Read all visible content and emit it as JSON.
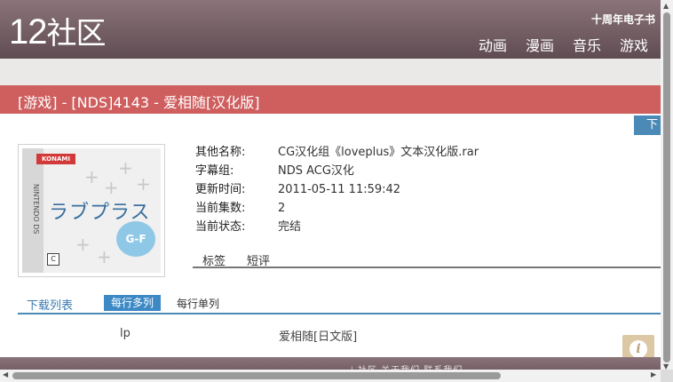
{
  "site": {
    "logo_num": "12",
    "logo_cn": "社区",
    "top_link": "十周年电子书",
    "nav": [
      "动画",
      "漫画",
      "音乐",
      "游戏"
    ]
  },
  "page": {
    "title": "[游戏] - [NDS]4143 - 爱相随[汉化版]",
    "download_tab": "下"
  },
  "cover": {
    "brand": "KONAMI",
    "platform": "NINTENDO DS",
    "title": "ラブプラス",
    "badge": "G-F",
    "rating": "C"
  },
  "info": [
    {
      "key": "其他名称:",
      "value": "CG汉化组《loveplus》文本汉化版.rar"
    },
    {
      "key": "字幕组:",
      "value": "NDS ACG汉化"
    },
    {
      "key": "更新时间:",
      "value": "2011-05-11 11:59:42"
    },
    {
      "key": "当前集数:",
      "value": "2"
    },
    {
      "key": "当前状态:",
      "value": "完结"
    }
  ],
  "tabs_top": [
    "标签",
    "短评"
  ],
  "download": {
    "list_label": "下载列表",
    "multi_label": "每行多列",
    "single_label": "每行单列",
    "item_name": "lp",
    "item_title": "爱相随[日文版]"
  },
  "footer": {
    "text": "i 社区  关于我们  联系我们"
  },
  "colors": {
    "header": "#6e5a60",
    "title_bar": "#cf5f5f",
    "accent_blue": "#3d89c6",
    "info_button": "#dcc8a4"
  }
}
